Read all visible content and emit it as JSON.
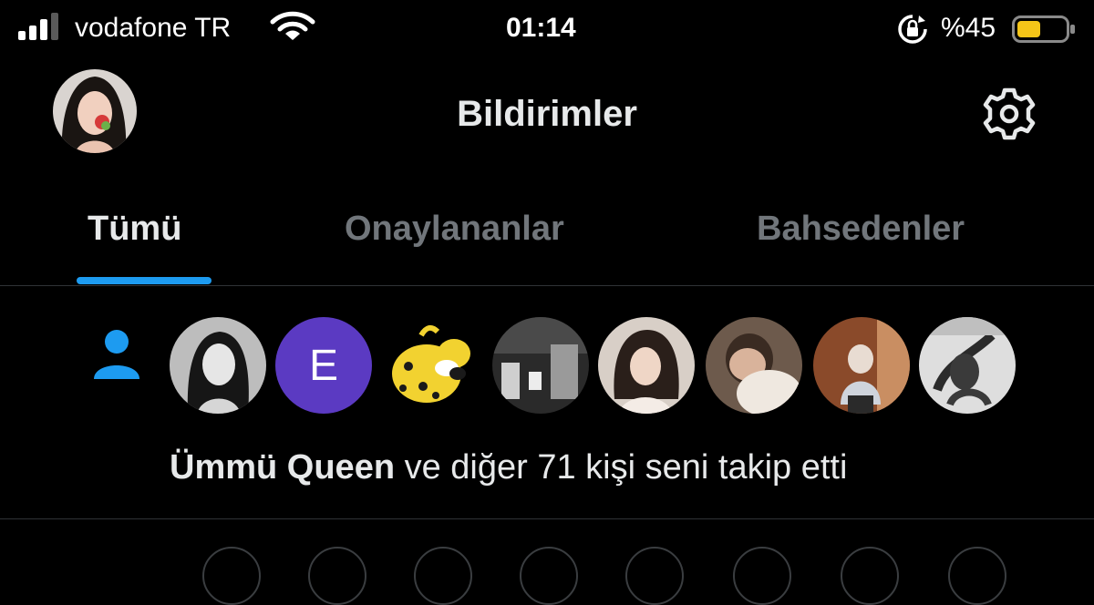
{
  "status_bar": {
    "carrier": "vodafone TR",
    "time": "01:14",
    "battery": "%45",
    "battery_level": 0.45,
    "icons": [
      "signal-icon",
      "wifi-icon",
      "orientation-lock-icon",
      "battery-icon"
    ]
  },
  "header": {
    "title": "Bildirimler",
    "icons": [
      "profile-avatar",
      "settings-gear-icon"
    ]
  },
  "tabs": [
    {
      "label": "Tümü",
      "active": true
    },
    {
      "label": "Onaylananlar",
      "active": false
    },
    {
      "label": "Bahsedenler",
      "active": false
    }
  ],
  "notification": {
    "icon": "person-follow-icon",
    "avatars": [
      "photo",
      "E",
      "cartoon",
      "photo",
      "photo",
      "photo",
      "photo",
      "photo"
    ],
    "name": "Ümmü Queen",
    "text": "ve diğer 71 kişi seni takip etti"
  },
  "colors": {
    "background": "#000000",
    "accent": "#1d9bf0",
    "text": "#e7e9ea",
    "muted": "#71767b",
    "divider": "#2f3336",
    "battery": "#f5c518",
    "avatar_letter_bg": "#5b3ac2"
  }
}
